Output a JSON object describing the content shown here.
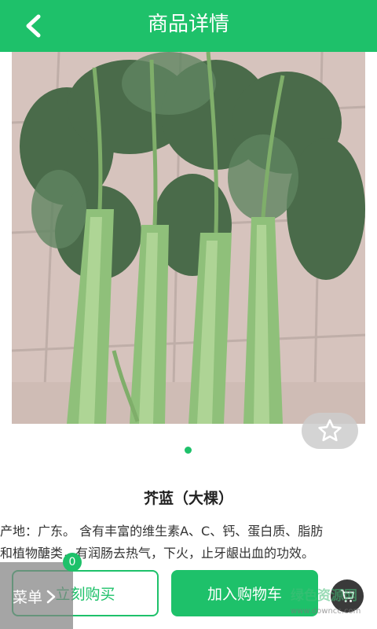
{
  "header": {
    "title": "商品详情",
    "back_icon": "chevron-left-icon"
  },
  "product": {
    "name": "芥蓝（大棵）",
    "description_line1": "产地：广东。 含有丰富的维生素A、C、钙、蛋白质、脂肪",
    "description_line2": "和植物醣类，有润肠去热气，下火，止牙龈出血的功效。",
    "image_alt": "芥蓝"
  },
  "gallery": {
    "fav_icon": "star-outline-icon",
    "active_page": 1,
    "total_pages": 1
  },
  "actions": {
    "buy_now": "立刻购买",
    "add_to_cart": "加入购物车",
    "cart_icon": "cart-icon"
  },
  "menu": {
    "label": "菜单",
    "badge_count": "0"
  },
  "watermark": {
    "text": "绿色资源网",
    "sub": "www.downcc.com"
  },
  "colors": {
    "primary": "#1ec16a",
    "menu_overlay": "#828282"
  }
}
